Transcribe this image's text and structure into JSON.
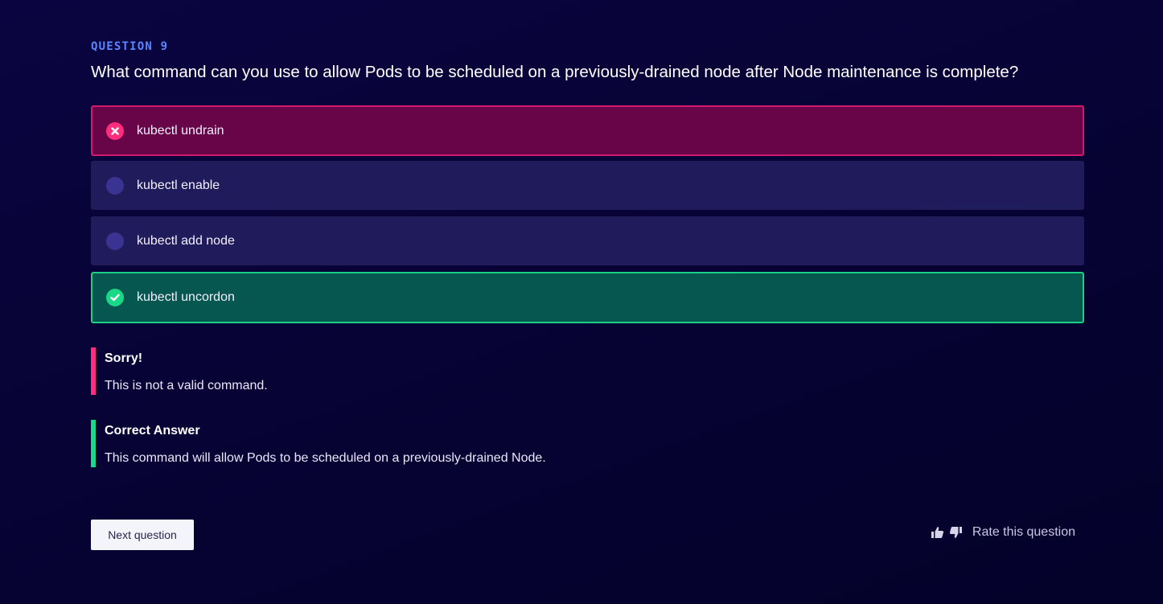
{
  "question": {
    "number_label": "QUESTION 9",
    "text": "What command can you use to allow Pods to be scheduled on a previously-drained node after Node maintenance is complete?"
  },
  "options": [
    {
      "label": "kubectl undrain",
      "state": "wrong",
      "icon": "x-circle-icon"
    },
    {
      "label": "kubectl enable",
      "state": "unselected",
      "icon": "radio-empty-icon"
    },
    {
      "label": "kubectl add node",
      "state": "unselected",
      "icon": "radio-empty-icon"
    },
    {
      "label": "kubectl uncordon",
      "state": "correct",
      "icon": "check-circle-icon"
    }
  ],
  "feedback": {
    "sorry": {
      "title": "Sorry!",
      "text": "This is not a valid command."
    },
    "correct": {
      "title": "Correct Answer",
      "text": "This command will allow Pods to be scheduled on a previously-drained Node."
    }
  },
  "footer": {
    "next_label": "Next question",
    "rate_label": "Rate this question"
  },
  "colors": {
    "accent_blue": "#5b86ff",
    "wrong": "#ff2d7c",
    "correct": "#19d887",
    "option_bg": "#201c5c"
  }
}
